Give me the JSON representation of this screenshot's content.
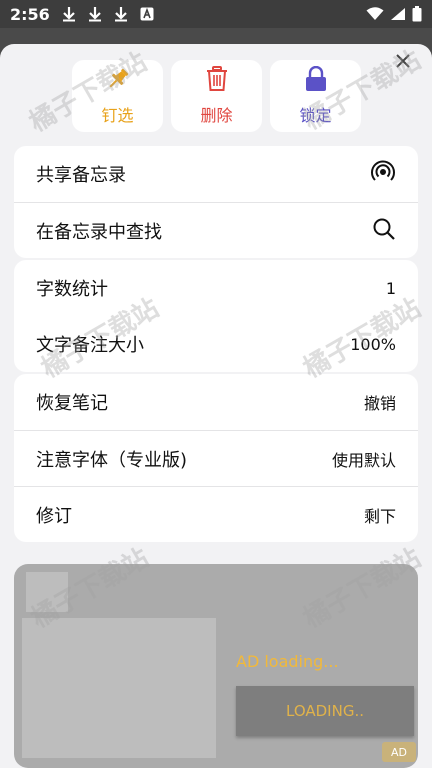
{
  "status_bar": {
    "time": "2:56",
    "icons_left": [
      "download-icon",
      "download-icon",
      "download-icon",
      "a-notification-icon"
    ],
    "icons_right": [
      "wifi-icon",
      "signal-icon",
      "battery-icon"
    ]
  },
  "actions": {
    "pin_label": "钉选",
    "delete_label": "删除",
    "lock_label": "锁定"
  },
  "menu": {
    "share": {
      "label": "共享备忘录",
      "icon": "share-broadcast-icon"
    },
    "find": {
      "label": "在备忘录中查找",
      "icon": "search-icon"
    },
    "word_count": {
      "label": "字数统计",
      "value": "1"
    },
    "text_size": {
      "label": "文字备注大小",
      "value": "100%"
    },
    "restore": {
      "label": "恢复笔记",
      "value": "撤销"
    },
    "font": {
      "label": "注意字体（专业版)",
      "value": "使用默认"
    },
    "revise": {
      "label": "修订",
      "value": "剩下"
    }
  },
  "ad": {
    "loading_text": "AD loading...",
    "loading_button": "LOADING..",
    "badge": "AD"
  },
  "watermark": "橘子下载站",
  "colors": {
    "pin": "#e8a21b",
    "delete": "#e0463f",
    "lock": "#5b52c7",
    "sheet_bg": "#f2f2f4"
  }
}
